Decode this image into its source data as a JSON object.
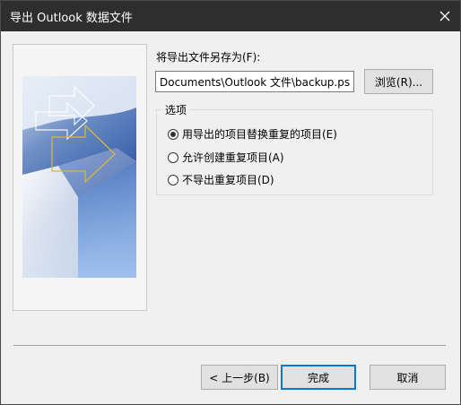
{
  "window": {
    "title": "导出 Outlook 数据文件",
    "close_icon": "close-icon"
  },
  "form": {
    "save_as_label": "将导出文件另存为(F):",
    "path_value": "Documents\\Outlook 文件\\backup.pst",
    "browse_label": "浏览(R)..."
  },
  "options": {
    "group_label": "选项",
    "items": [
      {
        "label": "用导出的项目替换重复的项目(E)",
        "selected": true
      },
      {
        "label": "允许创建重复项目(A)",
        "selected": false
      },
      {
        "label": "不导出重复项目(D)",
        "selected": false
      }
    ]
  },
  "footer": {
    "back_label": "< 上一步(B)",
    "finish_label": "完成",
    "cancel_label": "取消"
  },
  "colors": {
    "title_bar": "#2e2e2e",
    "accent": "#0078d7",
    "dialog_bg": "#f0f0f0"
  }
}
